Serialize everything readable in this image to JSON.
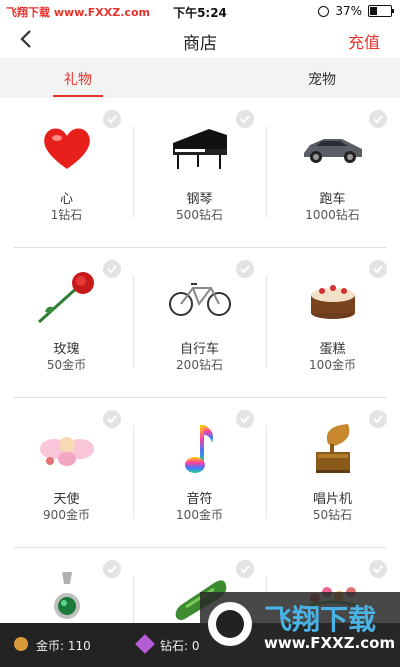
{
  "status_bar": {
    "watermark": "飞翔下载 www.FXXZ.com",
    "time": "下午5:24",
    "battery": "37%",
    "battery_level": 0.37
  },
  "nav": {
    "title": "商店",
    "recharge_label": "充值"
  },
  "tabs": [
    {
      "label": "礼物",
      "active": true
    },
    {
      "label": "宠物",
      "active": false
    }
  ],
  "items": [
    {
      "name": "心",
      "price": "1钻石",
      "icon": "heart-icon"
    },
    {
      "name": "钢琴",
      "price": "500钻石",
      "icon": "piano-icon"
    },
    {
      "name": "跑车",
      "price": "1000钻石",
      "icon": "sports-car-icon"
    },
    {
      "name": "玫瑰",
      "price": "50金币",
      "icon": "rose-icon"
    },
    {
      "name": "自行车",
      "price": "200钻石",
      "icon": "bicycle-icon"
    },
    {
      "name": "蛋糕",
      "price": "100金币",
      "icon": "cake-icon"
    },
    {
      "name": "天使",
      "price": "900金币",
      "icon": "angel-icon"
    },
    {
      "name": "音符",
      "price": "100金币",
      "icon": "music-note-icon"
    },
    {
      "name": "唱片机",
      "price": "50钻石",
      "icon": "gramophone-icon"
    },
    {
      "name": "",
      "price": "",
      "icon": "pendant-icon"
    },
    {
      "name": "",
      "price": "",
      "icon": "cucumber-icon"
    },
    {
      "name": "",
      "price": "",
      "icon": "flowers-icon"
    }
  ],
  "bottom_bar": {
    "coins_label": "金币: 110",
    "diamonds_label": "钻石: 0"
  },
  "watermark": {
    "title": "飞翔下载",
    "url": "www.FXXZ.com"
  },
  "colors": {
    "accent": "#e8322c",
    "bottom_bar": "#232323"
  }
}
